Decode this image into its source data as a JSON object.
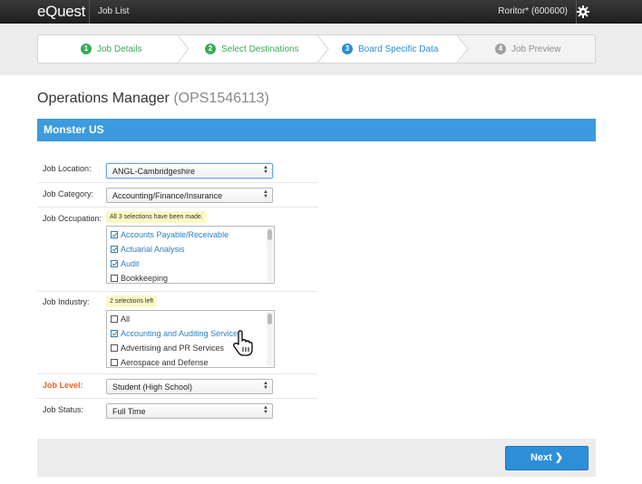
{
  "topbar": {
    "logo": "eQuest",
    "nav_link": "Job List",
    "user": "Roritor* (600600)",
    "settings_icon": "gear-icon"
  },
  "wizard": {
    "steps": [
      {
        "num": "1",
        "label": "Job Details",
        "state": "done"
      },
      {
        "num": "2",
        "label": "Select Destinations",
        "state": "done"
      },
      {
        "num": "3",
        "label": "Board Specific Data",
        "state": "active"
      },
      {
        "num": "4",
        "label": "Job Preview",
        "state": "pending"
      }
    ]
  },
  "page": {
    "title": "Operations Manager",
    "code": "(OPS1546113)"
  },
  "section": {
    "title": "Monster US"
  },
  "form": {
    "job_location": {
      "label": "Job Location:",
      "value": "ANGL-Cambridgeshire"
    },
    "job_category": {
      "label": "Job Category:",
      "value": "Accounting/Finance/Insurance"
    },
    "job_occupation": {
      "label": "Job Occupation:",
      "hint": "All 3 selections have been made.",
      "options": [
        {
          "label": "Accounts Payable/Receivable",
          "checked": true
        },
        {
          "label": "Actuarial Analysis",
          "checked": true
        },
        {
          "label": "Audit",
          "checked": true
        },
        {
          "label": "Bookkeeping",
          "checked": false
        }
      ]
    },
    "job_industry": {
      "label": "Job Industry:",
      "hint": "2 selections left",
      "options": [
        {
          "label": "All",
          "checked": false
        },
        {
          "label": "Accounting and Auditing Services",
          "checked": true
        },
        {
          "label": "Advertising and PR Services",
          "checked": false
        },
        {
          "label": "Aerospace and Defense",
          "checked": false
        }
      ]
    },
    "job_level": {
      "label": "Job Level:",
      "value": "Student (High School)",
      "required": true
    },
    "job_status": {
      "label": "Job Status:",
      "value": "Full Time"
    }
  },
  "footer": {
    "next_label": "Next"
  },
  "colors": {
    "accent": "#3d9ade",
    "done": "#3bab57",
    "active": "#2a8fd6",
    "required": "#e8631d"
  }
}
